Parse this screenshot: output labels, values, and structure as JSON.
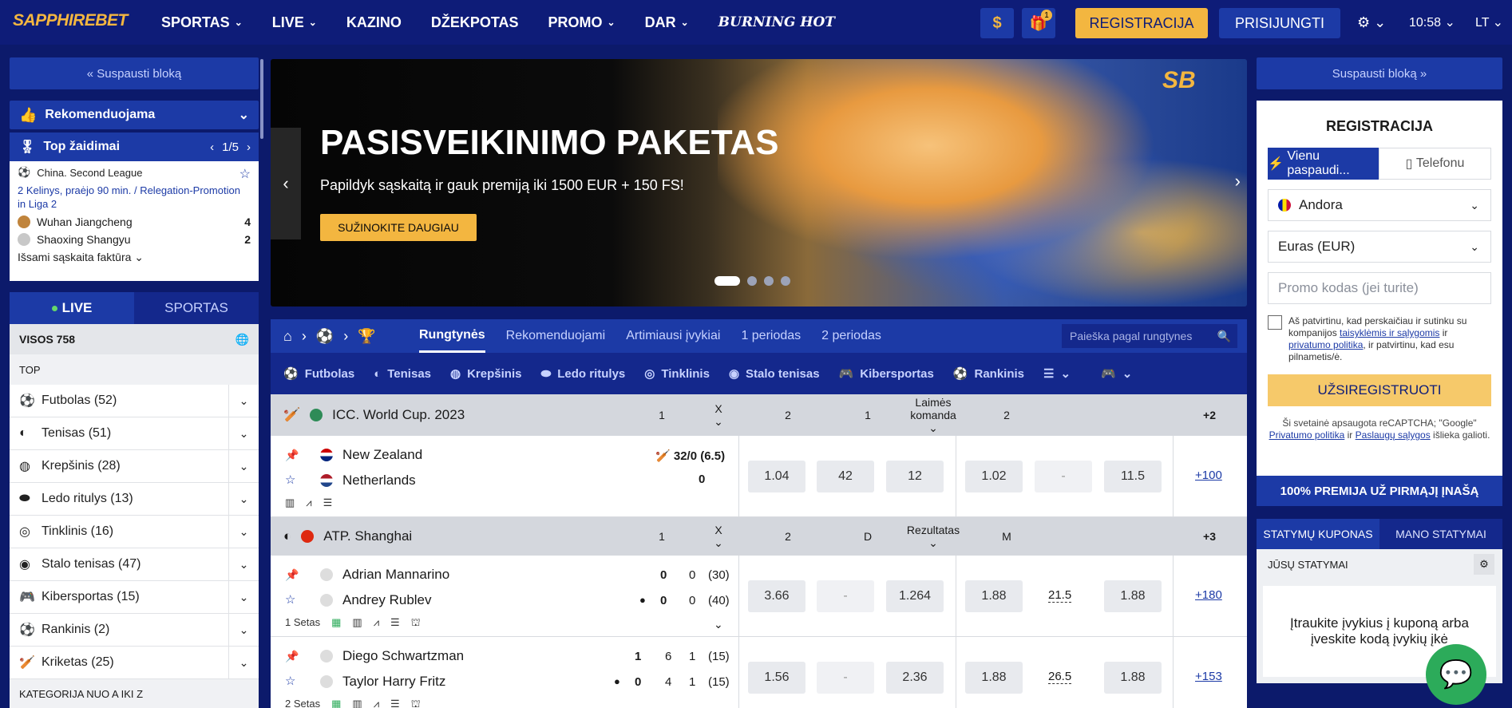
{
  "header": {
    "logo": "SAPPHIREBET",
    "nav": [
      {
        "label": "SPORTAS",
        "has_chevron": true
      },
      {
        "label": "LIVE",
        "has_chevron": true
      },
      {
        "label": "KAZINO",
        "has_chevron": false
      },
      {
        "label": "DŽEKPOTAS",
        "has_chevron": false
      },
      {
        "label": "PROMO",
        "has_chevron": true
      },
      {
        "label": "DAR",
        "has_chevron": true
      },
      {
        "label": "BURNING HOT",
        "has_chevron": false
      }
    ],
    "currency_icon": "dollar-icon",
    "gift_badge": "1",
    "register_label": "REGISTRACIJA",
    "login_label": "PRISIJUNGTI",
    "time": "10:58",
    "language": "LT"
  },
  "left": {
    "collapse_label": "Suspausti bloką",
    "recommended_label": "Rekomenduojama",
    "top_games_label": "Top žaidimai",
    "top_games_pager": "1/5",
    "match": {
      "league": "China. Second League",
      "stage": "2 Kelinys, praėjo 90 min. / Relegation-Promotion in Liga 2",
      "team1": "Wuhan Jiangcheng",
      "score1": "4",
      "team2": "Shaoxing Shangyu",
      "score2": "2",
      "invoice": "Išsami sąskaita faktūra"
    },
    "tabs": {
      "live": "LIVE",
      "sports": "SPORTAS"
    },
    "all_label": "VISOS 758",
    "top_label": "TOP",
    "sports": [
      {
        "label": "Futbolas (52)",
        "icon": "soccer-icon",
        "glyph": "⚽"
      },
      {
        "label": "Tenisas (51)",
        "icon": "tennis-icon",
        "glyph": "◐"
      },
      {
        "label": "Krepšinis (28)",
        "icon": "basketball-icon",
        "glyph": "◍"
      },
      {
        "label": "Ledo ritulys (13)",
        "icon": "hockey-icon",
        "glyph": "⬬"
      },
      {
        "label": "Tinklinis (16)",
        "icon": "volleyball-icon",
        "glyph": "◎"
      },
      {
        "label": "Stalo tenisas (47)",
        "icon": "table-tennis-icon",
        "glyph": "◉"
      },
      {
        "label": "Kibersportas (15)",
        "icon": "gamepad-icon",
        "glyph": "🎮"
      },
      {
        "label": "Rankinis (2)",
        "icon": "handball-icon",
        "glyph": "⚽"
      },
      {
        "label": "Kriketas (25)",
        "icon": "cricket-icon",
        "glyph": "🏏"
      }
    ],
    "category_label": "KATEGORIJA NUO A IKI Z"
  },
  "banner": {
    "title": "PASISVEIKINIMO PAKETAS",
    "subtitle": "Papildyk sąskaitą ir gauk premiją iki 1500 EUR + 150 FS!",
    "cta": "SUŽINOKITE DAUGIAU",
    "logo_text": "SB"
  },
  "events": {
    "tabs": [
      "Rungtynės",
      "Rekomenduojami",
      "Artimiausi įvykiai",
      "1 periodas",
      "2 periodas"
    ],
    "search_placeholder": "Paieška pagal rungtynes",
    "sports_nav": [
      "Futbolas",
      "Tenisas",
      "Krepšinis",
      "Ledo ritulys",
      "Tinklinis",
      "Stalo tenisas",
      "Kibersportas",
      "Rankinis"
    ],
    "cricket_league": {
      "name": "ICC. World Cup. 2023",
      "cols": [
        "1",
        "X",
        "2",
        "1",
        "Laimės komanda",
        "2",
        "+2"
      ],
      "team1": "New Zealand",
      "team2": "Netherlands",
      "score1": "32/0 (6.5)",
      "score2": "0",
      "odds": [
        "1.04",
        "42",
        "12",
        "1.02",
        "-",
        "11.5"
      ],
      "more": "+100"
    },
    "tennis_league": {
      "name": "ATP. Shanghai",
      "cols": [
        "1",
        "X",
        "2",
        "D",
        "Rezultatas",
        "M",
        "+3"
      ],
      "set_label": "1 Setas"
    },
    "tennis_matches": [
      {
        "team1": "Adrian Mannarino",
        "team2": "Andrey Rublev",
        "s1": [
          "0",
          "0",
          "(30)"
        ],
        "s2": [
          "0",
          "0",
          "(40)"
        ],
        "odds": [
          "3.66",
          "-",
          "1.264",
          "1.88",
          "21.5",
          "1.88"
        ],
        "more": "+180"
      },
      {
        "team1": "Diego Schwartzman",
        "team2": "Taylor Harry Fritz",
        "s1": [
          "1",
          "6",
          "1",
          "(15)"
        ],
        "s2": [
          "0",
          "4",
          "1",
          "(15)"
        ],
        "odds": [
          "1.56",
          "-",
          "2.36",
          "1.88",
          "26.5",
          "1.88"
        ],
        "more": "+153",
        "set_label": "2 Setas"
      }
    ]
  },
  "right": {
    "collapse_label": "Suspausti bloką",
    "reg_title": "REGISTRACIJA",
    "method_one_click": "Vienu paspaudi...",
    "method_phone": "Telefonu",
    "country": "Andora",
    "currency": "Euras (EUR)",
    "promo_placeholder": "Promo kodas (jei turite)",
    "consent_a": "Aš patvirtinu, kad perskaičiau ir sutinku su kompanijos",
    "consent_link1": "taisyklėmis ir sąlygomis",
    "consent_b": "ir",
    "consent_link2": "privatumo politika",
    "consent_c": ", ir patvirtinu, kad esu pilnametis/ė.",
    "submit": "UŽSIREGISTRUOTI",
    "recaptcha_a": "Ši svetainė apsaugota reCAPTCHA; \"Google\"",
    "recaptcha_link1": "Privatumo politika",
    "recaptcha_b": "ir",
    "recaptcha_link2": "Paslaugų sąlygos",
    "recaptcha_c": "išlieka galioti.",
    "promo_banner": "100% PREMIJA UŽ PIRMĄJĮ ĮNAŠĄ",
    "coupon_tab": "STATYMŲ KUPONAS",
    "my_bets_tab": "MANO STATYMAI",
    "your_bets": "JŪSŲ STATYMAI",
    "coupon_empty": "Įtraukite įvykius į kuponą arba įveskite kodą įvykių įkė"
  }
}
